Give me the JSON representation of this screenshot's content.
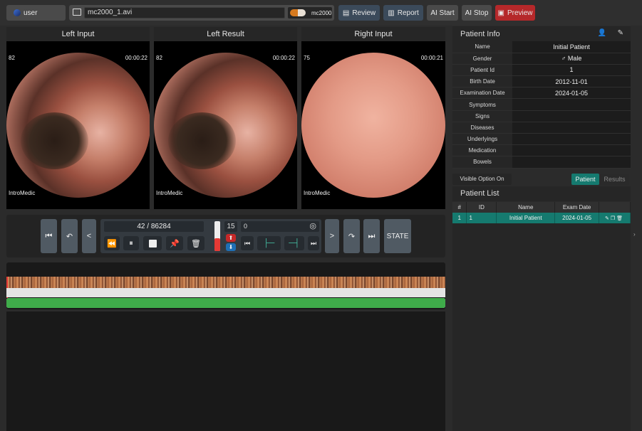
{
  "toolbar": {
    "user_label": "user",
    "file_name": "mc2000_1.avi",
    "model_name": "mc2000",
    "review_label": "Review",
    "report_label": "Report",
    "ai_start_label": "AI Start",
    "ai_stop_label": "AI Stop",
    "preview_label": "Preview"
  },
  "views": [
    {
      "title": "Left Input",
      "frame": "82",
      "time": "00:00:22",
      "brand": "IntroMedic"
    },
    {
      "title": "Left Result",
      "frame": "82",
      "time": "00:00:22",
      "brand": "IntroMedic"
    },
    {
      "title": "Right Input",
      "frame": "75",
      "time": "00:00:21",
      "brand": "IntroMedic"
    }
  ],
  "controls": {
    "frame_counter": "42 / 86284",
    "speed": "15",
    "search_value": "0",
    "prev_label": "<",
    "next_label": ">",
    "state_label": "STATE"
  },
  "patient_info": {
    "title": "Patient Info",
    "rows": [
      {
        "key": "Name",
        "value": "Initial Patient"
      },
      {
        "key": "Gender",
        "value": "♂ Male"
      },
      {
        "key": "Patient Id",
        "value": "1"
      },
      {
        "key": "Birth Date",
        "value": "2012-11-01"
      },
      {
        "key": "Examination Date",
        "value": "2024-01-05"
      },
      {
        "key": "Symptoms",
        "value": ""
      },
      {
        "key": "Signs",
        "value": ""
      },
      {
        "key": "Diseases",
        "value": ""
      },
      {
        "key": "Underlyings",
        "value": ""
      },
      {
        "key": "Medication",
        "value": ""
      },
      {
        "key": "Bowels",
        "value": ""
      }
    ],
    "visible_option_label": "Visible Option On",
    "tab_patient": "Patient",
    "tab_results": "Results"
  },
  "patient_list": {
    "title": "Patient List",
    "headers": [
      "#",
      "ID",
      "Name",
      "Exam Date",
      ""
    ],
    "rows": [
      {
        "num": "1",
        "id": "1",
        "name": "Initial Patient",
        "exam_date": "2024-01-05"
      }
    ]
  },
  "colors": {
    "accent_teal": "#157a6f",
    "preview_red": "#b5282a",
    "progress_green": "#3fac4a"
  },
  "timeline": {
    "progress_fraction": 1.0
  }
}
